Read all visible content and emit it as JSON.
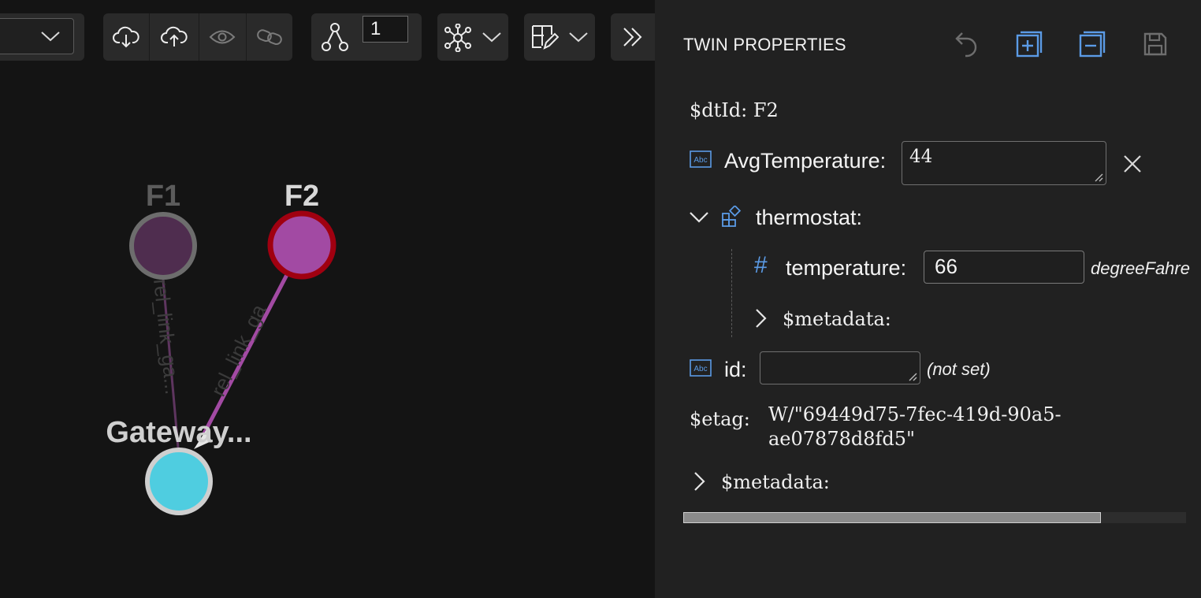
{
  "toolbar": {
    "depth_value": "1"
  },
  "graph": {
    "nodes": [
      {
        "id": "F1",
        "label": "F1"
      },
      {
        "id": "F2",
        "label": "F2"
      },
      {
        "id": "gateway",
        "label": "Gateway..."
      }
    ],
    "edges": [
      {
        "label": "rel_link_ga..."
      },
      {
        "label": "rel_link_ga"
      }
    ]
  },
  "panel": {
    "title": "TWIN PROPERTIES",
    "dtid_key": "$dtId:",
    "dtid_value": "F2",
    "avg_temp_label": "AvgTemperature:",
    "avg_temp_value": "44",
    "thermostat_label": "thermostat:",
    "temperature_label": "temperature:",
    "temperature_value": "66",
    "temperature_unit": "degreeFahre",
    "nested_metadata_label": "$metadata:",
    "id_label": "id:",
    "id_value": "",
    "id_status": "(not set)",
    "etag_key": "$etag:",
    "etag_line1": "W/\"69449d75-7fec-419d-90a5-",
    "etag_line2": "ae07878d8fd5\"",
    "metadata_label": "$metadata:",
    "abc_icon_text": "Abc",
    "hash_icon_text": "#"
  },
  "colors": {
    "accent": "#5b9be6",
    "f1_fill": "#4f2d4f",
    "f1_stroke": "#6d6d6d",
    "f2_fill": "#a24aa3",
    "f2_stroke": "#a00010",
    "gateway_fill": "#4fcde0",
    "gateway_stroke": "#cfcfcf",
    "edge_active": "#a24aa3"
  }
}
